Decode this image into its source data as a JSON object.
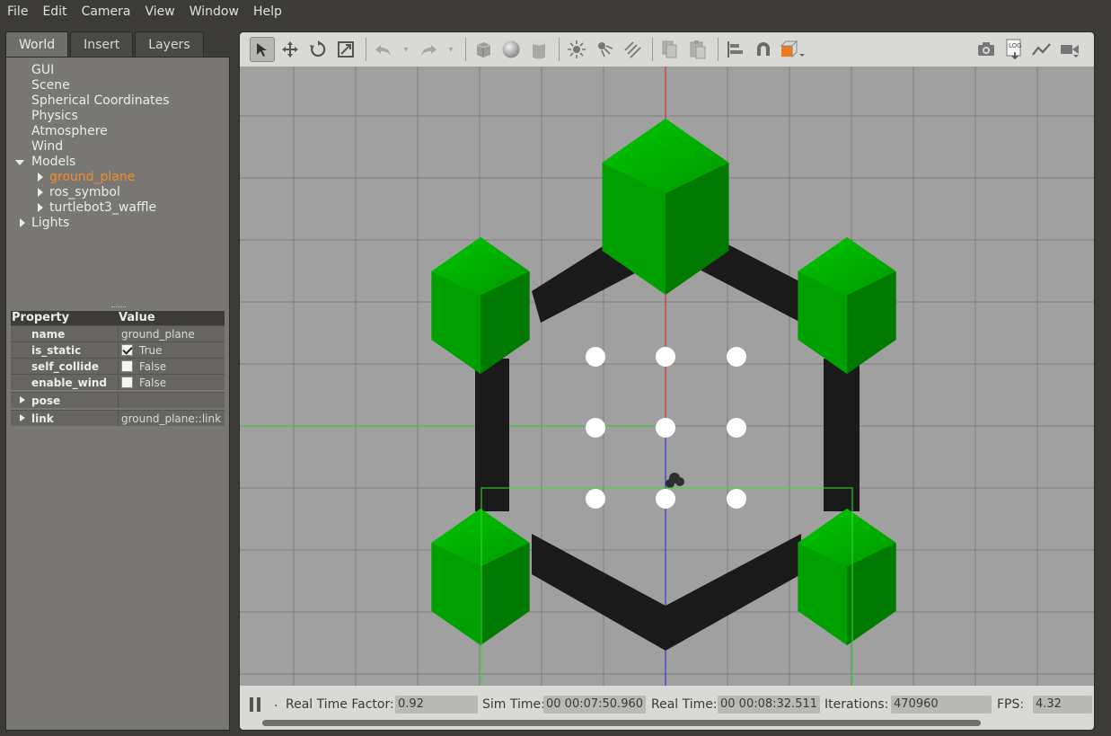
{
  "menu": [
    "File",
    "Edit",
    "Camera",
    "View",
    "Window",
    "Help"
  ],
  "tabs": [
    "World",
    "Insert",
    "Layers"
  ],
  "tree": {
    "gui": "GUI",
    "scene": "Scene",
    "spherical": "Spherical Coordinates",
    "physics": "Physics",
    "atmosphere": "Atmosphere",
    "wind": "Wind",
    "models": "Models",
    "model_items": [
      "ground_plane",
      "ros_symbol",
      "turtlebot3_waffle"
    ],
    "lights": "Lights"
  },
  "properties": {
    "col_property": "Property",
    "col_value": "Value",
    "name_key": "name",
    "name_value": "ground_plane",
    "is_static_key": "is_static",
    "is_static_value": "True",
    "self_collide_key": "self_collide",
    "self_collide_value": "False",
    "enable_wind_key": "enable_wind",
    "enable_wind_value": "False",
    "pose_key": "pose",
    "link_key": "link",
    "link_value": "ground_plane::link"
  },
  "toolbar_icons": [
    "select-icon",
    "translate-icon",
    "rotate-icon",
    "scale-icon",
    "undo-icon",
    "redo-icon",
    "box-icon",
    "sphere-icon",
    "cylinder-icon",
    "point-light-icon",
    "spot-light-icon",
    "directional-light-icon",
    "copy-icon",
    "paste-icon",
    "align-icon",
    "snap-icon",
    "view-angle-icon",
    "screenshot-icon",
    "log-icon",
    "plot-icon",
    "video-icon"
  ],
  "status": {
    "real_time_factor_label": "Real Time Factor:",
    "real_time_factor": "0.92",
    "sim_time_label": "Sim Time:",
    "sim_time": "00 00:07:50.960",
    "real_time_label": "Real Time:",
    "real_time": "00 00:08:32.511",
    "iterations_label": "Iterations:",
    "iterations": "470960",
    "fps_label": "FPS:",
    "fps": "4.32"
  },
  "colors": {
    "ground": "#a0a0a0",
    "grid": "#7e7e7e",
    "hex_green": "#00b400",
    "hex_green_dark": "#007a00",
    "beam": "#1a1a1a",
    "x_axis": "#e02020",
    "y_axis": "#20d020",
    "z_axis": "#2020e0",
    "selection_box": "#30e030"
  }
}
